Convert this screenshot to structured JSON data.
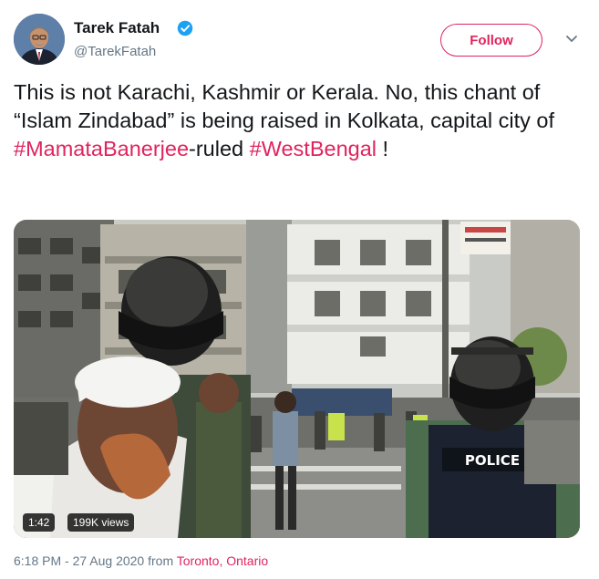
{
  "author": {
    "display_name": "Tarek Fatah",
    "handle": "@TarekFatah",
    "verified": true,
    "avatar_icon": "profile-photo"
  },
  "follow_label": "Follow",
  "menu_icon": "chevron-down-icon",
  "tweet": {
    "text_1": "This is not Karachi, Kashmir or Kerala. No, this chant of “Islam Zindabad” is being raised in Kolkata, capital city of ",
    "hashtag_1": "#MamataBanerjee",
    "text_2": "-ruled ",
    "hashtag_2": "#WestBengal",
    "text_3": " !"
  },
  "media": {
    "type": "video",
    "duration": "1:42",
    "views": "199K views",
    "police_label": "POLICE"
  },
  "meta": {
    "time": "6:18 PM - 27 Aug 2020 from ",
    "city": "Toronto",
    "sep": ", ",
    "region": "Ontario"
  },
  "colors": {
    "accent": "#e0245e",
    "verified": "#1da1f2",
    "text": "#14171a",
    "muted": "#657786"
  }
}
